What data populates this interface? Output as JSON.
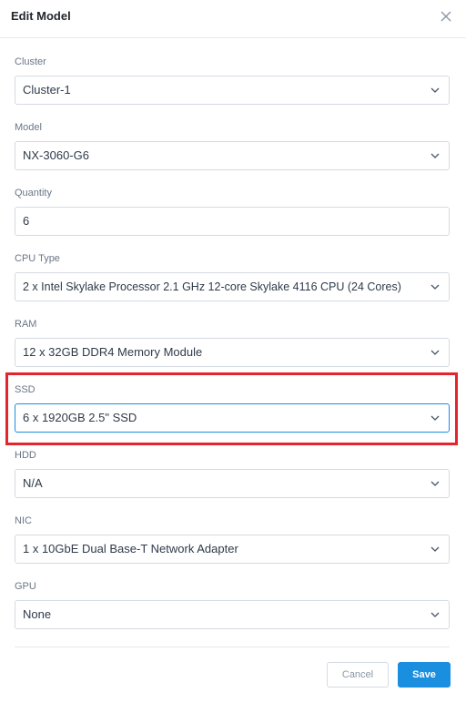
{
  "modal": {
    "title": "Edit Model",
    "close_icon": "close-icon"
  },
  "fields": {
    "cluster": {
      "label": "Cluster",
      "value": "Cluster-1"
    },
    "model": {
      "label": "Model",
      "value": "NX-3060-G6"
    },
    "quantity": {
      "label": "Quantity",
      "value": "6"
    },
    "cpu": {
      "label": "CPU Type",
      "value": "2 x Intel Skylake Processor 2.1 GHz 12-core Skylake 4116 CPU (24 Cores)"
    },
    "ram": {
      "label": "RAM",
      "value": "12 x 32GB DDR4 Memory Module"
    },
    "ssd": {
      "label": "SSD",
      "value": "6 x 1920GB 2.5\" SSD"
    },
    "hdd": {
      "label": "HDD",
      "value": "N/A"
    },
    "nic": {
      "label": "NIC",
      "value": "1 x 10GbE Dual Base-T Network Adapter"
    },
    "gpu": {
      "label": "GPU",
      "value": "None"
    }
  },
  "footer": {
    "cancel_label": "Cancel",
    "save_label": "Save"
  },
  "colors": {
    "accent": "#1a8fe0",
    "highlight": "#e3262e"
  },
  "icons": [
    "close-icon",
    "chevron-down-icon"
  ]
}
